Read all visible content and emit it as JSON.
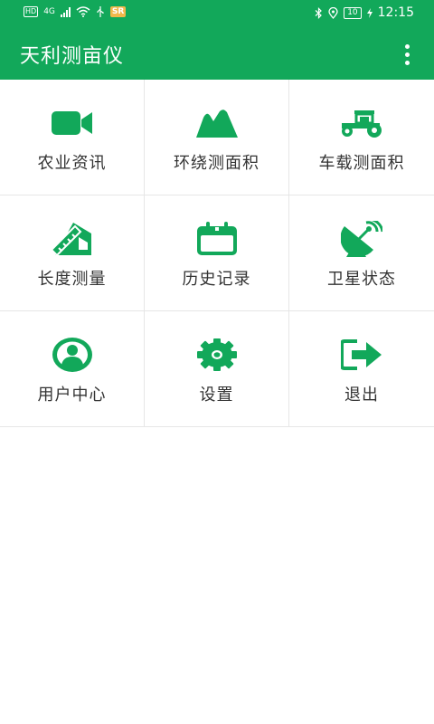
{
  "status_bar": {
    "hd": "HD",
    "network": "4G",
    "app_badge": "SR",
    "battery": "10",
    "time": "12:15"
  },
  "app_bar": {
    "title": "天利测亩仪"
  },
  "menu": [
    {
      "label": "农业资讯",
      "icon": "video-camera-icon"
    },
    {
      "label": "环绕测面积",
      "icon": "mountain-icon"
    },
    {
      "label": "车载测面积",
      "icon": "tractor-icon"
    },
    {
      "label": "长度测量",
      "icon": "ruler-icon"
    },
    {
      "label": "历史记录",
      "icon": "calendar-icon"
    },
    {
      "label": "卫星状态",
      "icon": "satellite-dish-icon"
    },
    {
      "label": "用户中心",
      "icon": "user-circle-icon"
    },
    {
      "label": "设置",
      "icon": "gear-icon"
    },
    {
      "label": "退出",
      "icon": "exit-icon"
    }
  ],
  "colors": {
    "primary": "#12a85a",
    "icon": "#12a85a",
    "text": "#333333",
    "divider": "#e6e6e6"
  }
}
